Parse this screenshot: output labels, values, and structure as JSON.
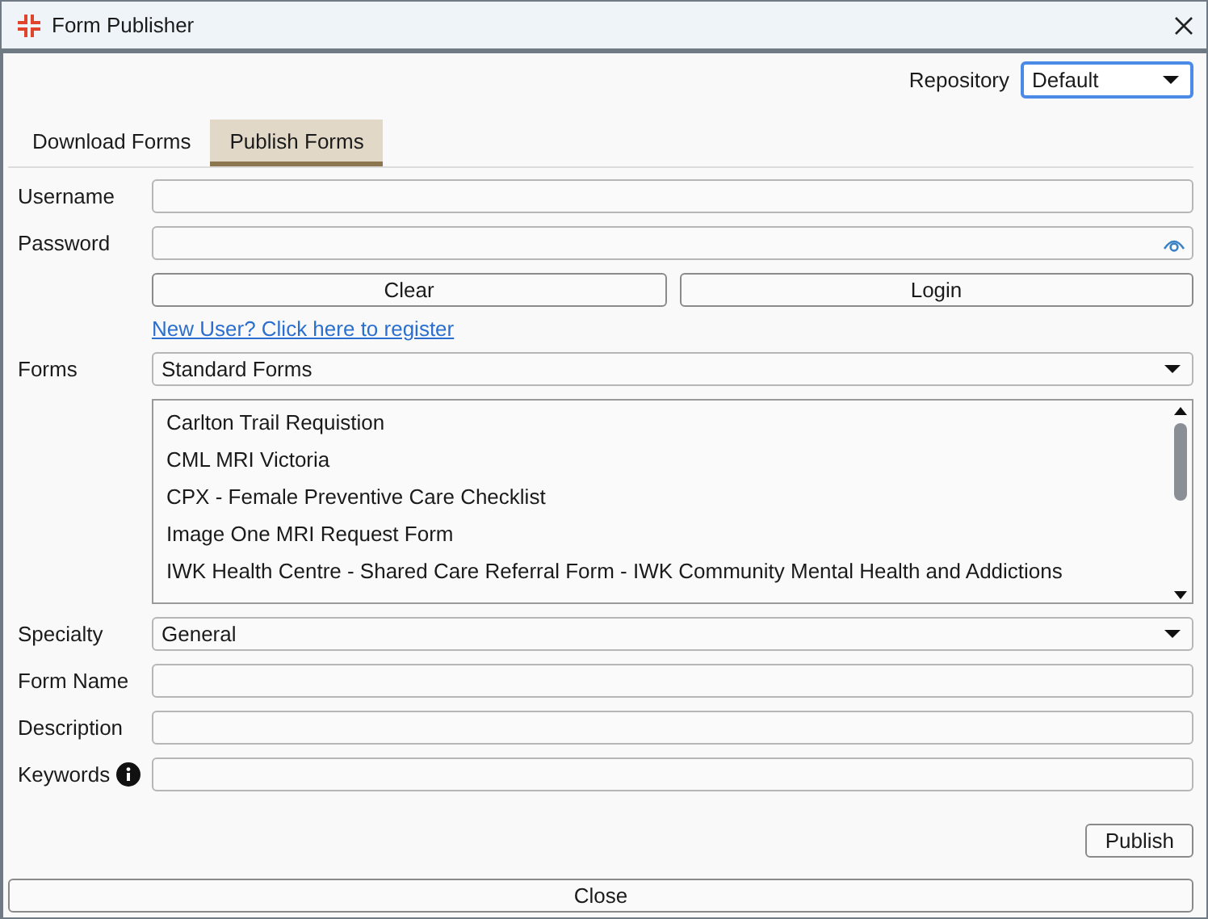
{
  "window": {
    "title": "Form Publisher"
  },
  "repository": {
    "label": "Repository",
    "value": "Default"
  },
  "tabs": [
    {
      "label": "Download Forms",
      "selected": false
    },
    {
      "label": "Publish Forms",
      "selected": true
    }
  ],
  "username": {
    "label": "Username"
  },
  "password": {
    "label": "Password"
  },
  "buttons": [
    "Clear",
    "Login"
  ],
  "register_link": "New User? Click here to register",
  "forms": {
    "label": "Forms",
    "value": "Standard Forms",
    "items": [
      {
        "label": "Carlton Trail Requistion",
        "selected": false
      },
      {
        "label": "CML MRI Victoria",
        "selected": false
      },
      {
        "label": "CPX - Female Preventive Care Checklist",
        "selected": false
      },
      {
        "label": "Image One MRI Request Form",
        "selected": false
      },
      {
        "label": "IWK Health Centre - Shared Care Referral Form - IWK Community Mental Health and Addictions",
        "selected": false
      }
    ]
  },
  "specialty": {
    "label": "Specialty",
    "value": "General"
  },
  "form_name": {
    "label": "Form Name"
  },
  "description": {
    "label": "Description"
  },
  "keywords": {
    "label": "Keywords"
  },
  "publish_button": "Publish",
  "close_button": "Close"
}
